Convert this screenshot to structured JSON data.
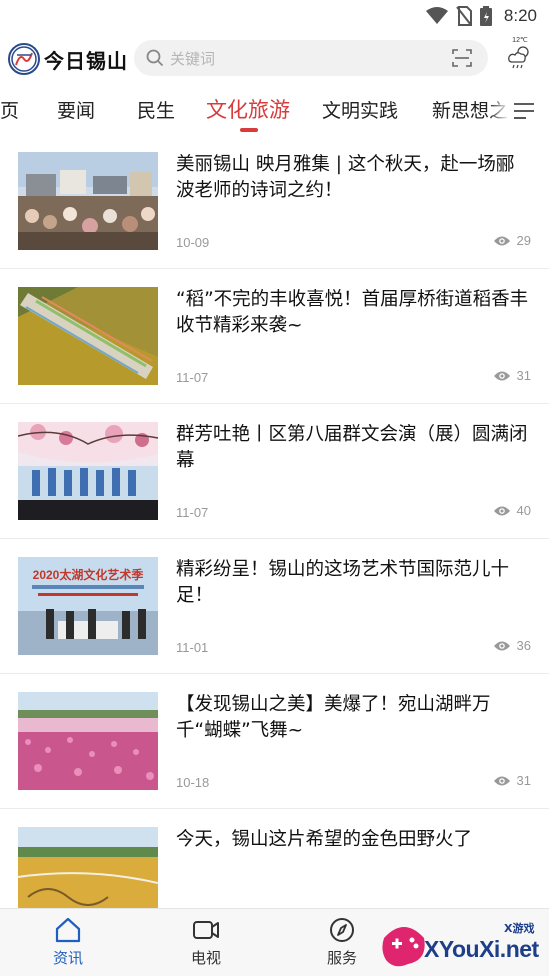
{
  "status_bar": {
    "time": "8:20",
    "icons": [
      "wifi-icon",
      "no-sim-icon",
      "battery-icon"
    ]
  },
  "header": {
    "logo_text": "今日锡山",
    "search_placeholder": "关键词",
    "weather": {
      "temp": "12℃",
      "icon": "cloudy-rain-icon"
    }
  },
  "tabs": {
    "items": [
      {
        "label": "页"
      },
      {
        "label": "要闻"
      },
      {
        "label": "民生"
      },
      {
        "label": "文化旅游"
      },
      {
        "label": "文明实践"
      },
      {
        "label": "新思想之"
      }
    ],
    "active_index": 3
  },
  "news": [
    {
      "title": "美丽锡山 映月雅集 | 这个秋天，赴一场郦波老师的诗词之约！",
      "date": "10-09",
      "views": "29"
    },
    {
      "title": "“稻”不完的丰收喜悦！首届厚桥街道稻香丰收节精彩来袭~",
      "date": "11-07",
      "views": "31"
    },
    {
      "title": "群芳吐艳丨区第八届群文会演（展）圆满闭幕",
      "date": "11-07",
      "views": "40"
    },
    {
      "title": "精彩纷呈！锡山的这场艺术节国际范儿十足！",
      "date": "11-01",
      "views": "36",
      "thumb_banner": "2020太湖文化艺术季"
    },
    {
      "title": "【发现锡山之美】美爆了！宛山湖畔万千“蝴蝶”飞舞~",
      "date": "10-18",
      "views": "31"
    },
    {
      "title": "今天，锡山这片希望的金色田野火了"
    }
  ],
  "bottom_nav": {
    "items": [
      {
        "label": "资讯",
        "icon": "home-icon"
      },
      {
        "label": "电视",
        "icon": "tv-icon"
      },
      {
        "label": "服务",
        "icon": "compass-icon"
      }
    ],
    "active_index": 0
  },
  "watermark": {
    "text": "XYouXi.net",
    "top_text": "X游戏"
  },
  "colors": {
    "accent": "#d83b3b",
    "nav_active": "#1f5fbf"
  }
}
